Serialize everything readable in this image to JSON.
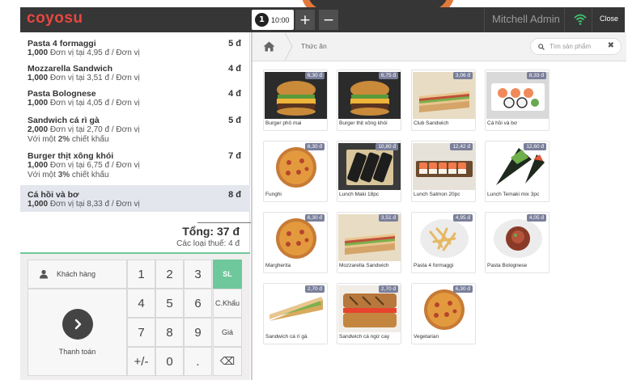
{
  "header": {
    "logo": "coyosu",
    "order_number": "1",
    "order_time": "10:00",
    "add_order": "+",
    "remove_order": "−",
    "user": "Mitchell Admin",
    "close_label": "Close"
  },
  "order": {
    "lines": [
      {
        "name": "Pasta 4 formaggi",
        "qty": "1,000",
        "detail": "Đơn vị tại 4,95 đ / Đơn vị",
        "price": "5 đ",
        "discount": "",
        "discount_pct": ""
      },
      {
        "name": "Mozzarella Sandwich",
        "qty": "1,000",
        "detail": "Đơn vị tại 3,51 đ / Đơn vị",
        "price": "4 đ",
        "discount": "",
        "discount_pct": ""
      },
      {
        "name": "Pasta Bolognese",
        "qty": "1,000",
        "detail": "Đơn vị tại 4,05 đ / Đơn vị",
        "price": "4 đ",
        "discount": "",
        "discount_pct": ""
      },
      {
        "name": "Sandwich cá rì gà",
        "qty": "2,000",
        "detail": "Đơn vị tại 2,70 đ / Đơn vị",
        "price": "5 đ",
        "discount_pre": "Với một",
        "discount_pct": "2%",
        "discount_post": "chiết khấu"
      },
      {
        "name": "Burger thịt xông khói",
        "qty": "1,000",
        "detail": "Đơn vị tại 6,75 đ / Đơn vị",
        "price": "7 đ",
        "discount_pre": "Với một",
        "discount_pct": "3%",
        "discount_post": "chiết khấu"
      },
      {
        "name": "Cá hồi và bơ",
        "qty": "1,000",
        "detail": "Đơn vị tại 8,33 đ / Đơn vị",
        "price": "8 đ",
        "discount": "",
        "discount_pct": ""
      }
    ],
    "total": "Tổng: 37 đ",
    "taxes": "Các loại thuế: 4 đ"
  },
  "numpad": {
    "customer": "Khách hàng",
    "payment": "Thanh toán",
    "keys": [
      "1",
      "2",
      "3",
      "4",
      "5",
      "6",
      "7",
      "8",
      "9",
      "+/-",
      "0",
      "."
    ],
    "qty": "SL",
    "disc": "C.Khấu",
    "price": "Giá",
    "backspace": "⌫"
  },
  "products_panel": {
    "category": "Thức ăn",
    "search_placeholder": "Tìm sản phẩm",
    "search_clear": "✖",
    "items": [
      {
        "name": "Burger phô mai",
        "price": "6,30 đ",
        "icon": "burger"
      },
      {
        "name": "Burger thịt xông khói",
        "price": "6,75 đ",
        "icon": "burger"
      },
      {
        "name": "Club Sandwich",
        "price": "3,06 đ",
        "icon": "sandwich"
      },
      {
        "name": "Cá hồi và bơ",
        "price": "8,33 đ",
        "icon": "sushi-plate"
      },
      {
        "name": "Funghi",
        "price": "6,30 đ",
        "icon": "pizza"
      },
      {
        "name": "Lunch Maki 18pc",
        "price": "10,80 đ",
        "icon": "maki"
      },
      {
        "name": "Lunch Salmon 20pc",
        "price": "12,42 đ",
        "icon": "salmon-sushi"
      },
      {
        "name": "Lunch Temaki mix 3pc",
        "price": "12,60 đ",
        "icon": "temaki"
      },
      {
        "name": "Margherita",
        "price": "6,30 đ",
        "icon": "pizza"
      },
      {
        "name": "Mozzarella Sandwich",
        "price": "3,51 đ",
        "icon": "sandwich"
      },
      {
        "name": "Pasta 4 formaggi",
        "price": "4,95 đ",
        "icon": "pasta"
      },
      {
        "name": "Pasta Bolognese",
        "price": "4,05 đ",
        "icon": "pasta-bolognese"
      },
      {
        "name": "Sandwich cá rì gà",
        "price": "2,70 đ",
        "icon": "triangle-sandwich"
      },
      {
        "name": "Sandwich cá ngừ cay",
        "price": "2,70 đ",
        "icon": "panini"
      },
      {
        "name": "Vegetarian",
        "price": "6,30 đ",
        "icon": "pizza"
      }
    ]
  }
}
